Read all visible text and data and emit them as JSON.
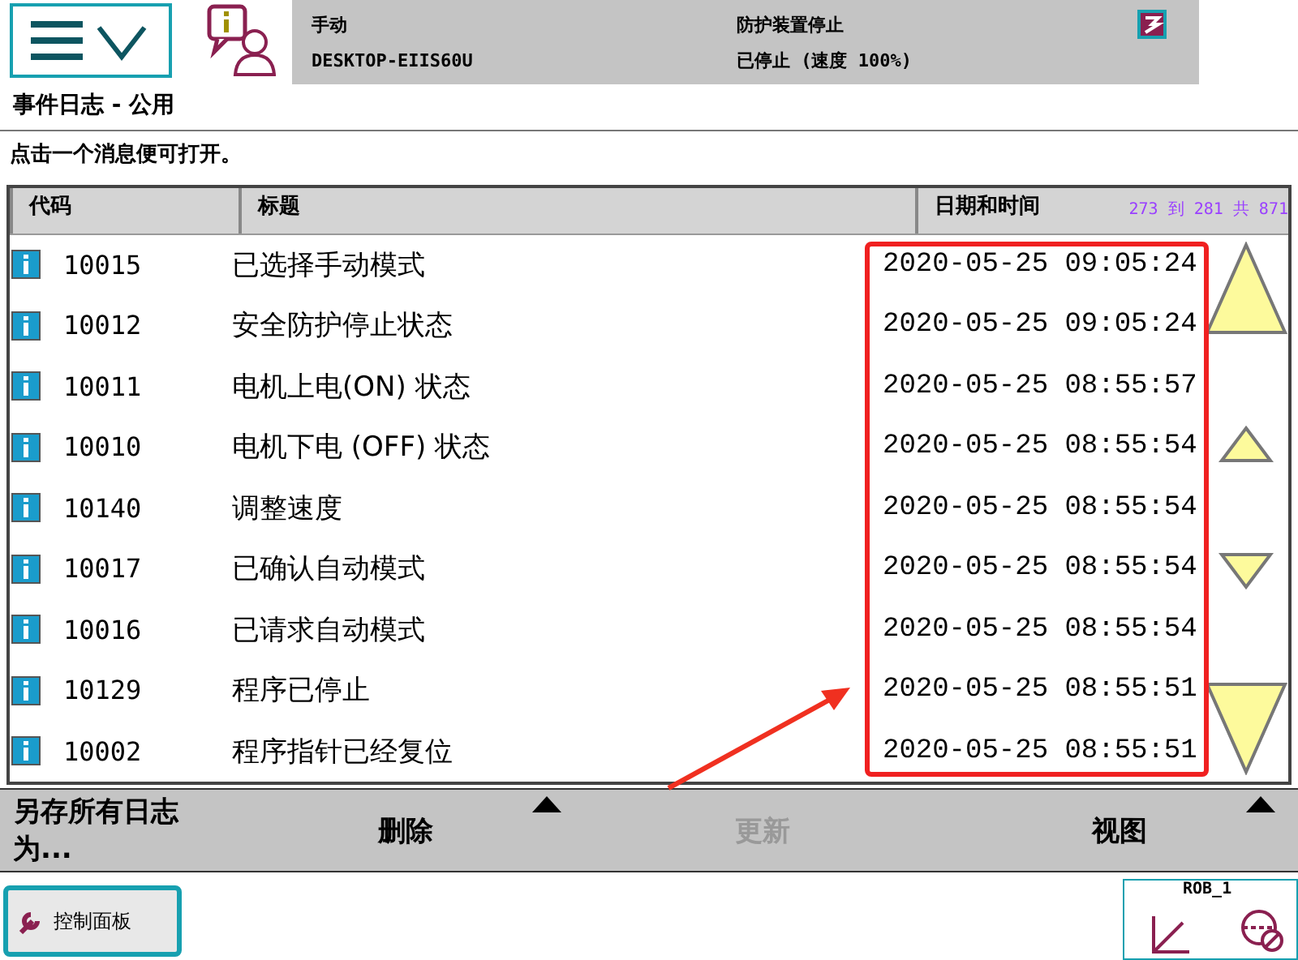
{
  "status_bar": {
    "mode": "手动",
    "system": "DESKTOP-EIIS60U",
    "safety": "防护装置停止",
    "run_state": "已停止 (速度 100%)"
  },
  "view_title": "事件日志 - 公用",
  "instruction": "点击一个消息便可打开。",
  "table": {
    "columns": [
      "代码",
      "标题",
      "日期和时间"
    ],
    "range": "273 到 281 共 871",
    "rows": [
      {
        "kind": "info",
        "code": "10015",
        "title": "已选择手动模式",
        "datetime": "2020-05-25 09:05:24"
      },
      {
        "kind": "info",
        "code": "10012",
        "title": "安全防护停止状态",
        "datetime": "2020-05-25 09:05:24"
      },
      {
        "kind": "info",
        "code": "10011",
        "title": "电机上电(ON) 状态",
        "datetime": "2020-05-25 08:55:57"
      },
      {
        "kind": "info",
        "code": "10010",
        "title": "电机下电 (OFF) 状态",
        "datetime": "2020-05-25 08:55:54"
      },
      {
        "kind": "info",
        "code": "10140",
        "title": "调整速度",
        "datetime": "2020-05-25 08:55:54"
      },
      {
        "kind": "info",
        "code": "10017",
        "title": "已确认自动模式",
        "datetime": "2020-05-25 08:55:54"
      },
      {
        "kind": "info",
        "code": "10016",
        "title": "已请求自动模式",
        "datetime": "2020-05-25 08:55:54"
      },
      {
        "kind": "info",
        "code": "10129",
        "title": "程序已停止",
        "datetime": "2020-05-25 08:55:51"
      },
      {
        "kind": "info",
        "code": "10002",
        "title": "程序指针已经复位",
        "datetime": "2020-05-25 08:55:51"
      }
    ]
  },
  "toolbar": [
    {
      "label": "另存所有日志为...",
      "disabled": false,
      "has_menu": false
    },
    {
      "label": "删除",
      "disabled": false,
      "has_menu": true
    },
    {
      "label": "更新",
      "disabled": true,
      "has_menu": false
    },
    {
      "label": "视图",
      "disabled": false,
      "has_menu": true
    }
  ],
  "taskbar": {
    "button": "控制面板",
    "robot": "ROB_1"
  }
}
